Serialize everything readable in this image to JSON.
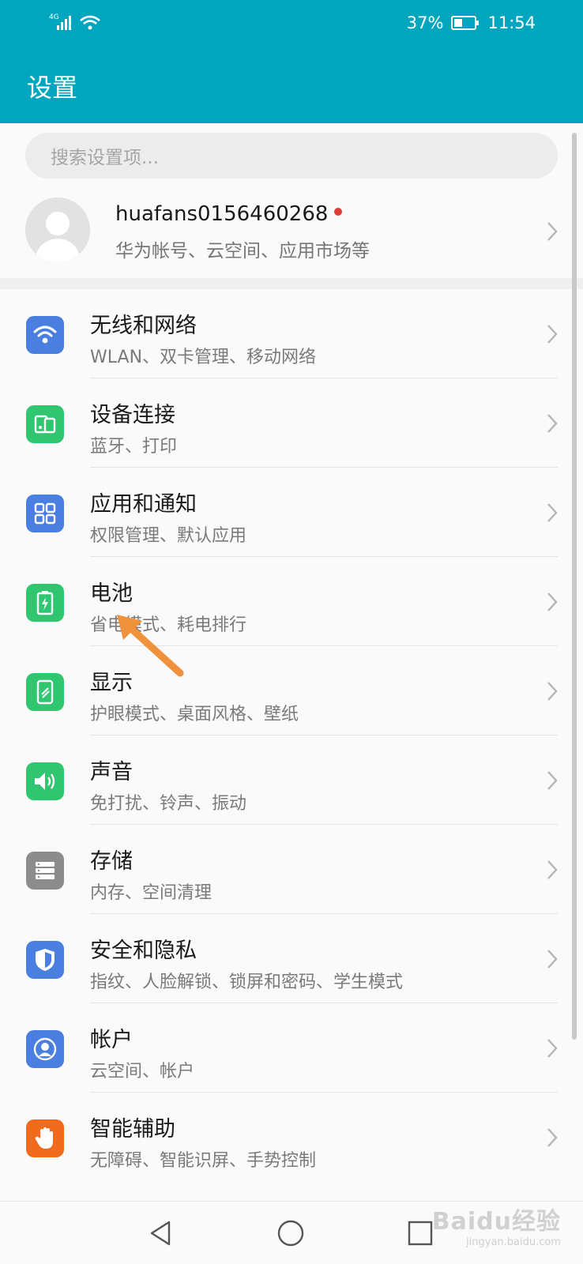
{
  "status_bar": {
    "network": "4G",
    "battery": "37%",
    "time": "11:54"
  },
  "header": {
    "title": "设置"
  },
  "search": {
    "placeholder": "搜索设置项..."
  },
  "account": {
    "name": "huafans0156460268",
    "subtitle": "华为帐号、云空间、应用市场等"
  },
  "items": [
    {
      "title": "无线和网络",
      "subtitle": "WLAN、双卡管理、移动网络",
      "icon": "wifi-icon",
      "color": "#4a7fe0"
    },
    {
      "title": "设备连接",
      "subtitle": "蓝牙、打印",
      "icon": "device-connect-icon",
      "color": "#2fc66f"
    },
    {
      "title": "应用和通知",
      "subtitle": "权限管理、默认应用",
      "icon": "apps-grid-icon",
      "color": "#4a7fe0"
    },
    {
      "title": "电池",
      "subtitle": "省电模式、耗电排行",
      "icon": "battery-icon",
      "color": "#2fc66f"
    },
    {
      "title": "显示",
      "subtitle": "护眼模式、桌面风格、壁纸",
      "icon": "display-icon",
      "color": "#2fc66f"
    },
    {
      "title": "声音",
      "subtitle": "免打扰、铃声、振动",
      "icon": "speaker-icon",
      "color": "#2fc66f"
    },
    {
      "title": "存储",
      "subtitle": "内存、空间清理",
      "icon": "storage-icon",
      "color": "#8c8c8c"
    },
    {
      "title": "安全和隐私",
      "subtitle": "指纹、人脸解锁、锁屏和密码、学生模式",
      "icon": "shield-icon",
      "color": "#4a7fe0"
    },
    {
      "title": "帐户",
      "subtitle": "云空间、帐户",
      "icon": "account-icon",
      "color": "#4a7fe0"
    },
    {
      "title": "智能辅助",
      "subtitle": "无障碍、智能识屏、手势控制",
      "icon": "hand-icon",
      "color": "#f26b1d"
    }
  ],
  "watermark": {
    "line1": "Baidu经验",
    "line2": "jingyan.baidu.com"
  },
  "colors": {
    "header": "#00a6be",
    "annotation_arrow": "#f0913c"
  }
}
